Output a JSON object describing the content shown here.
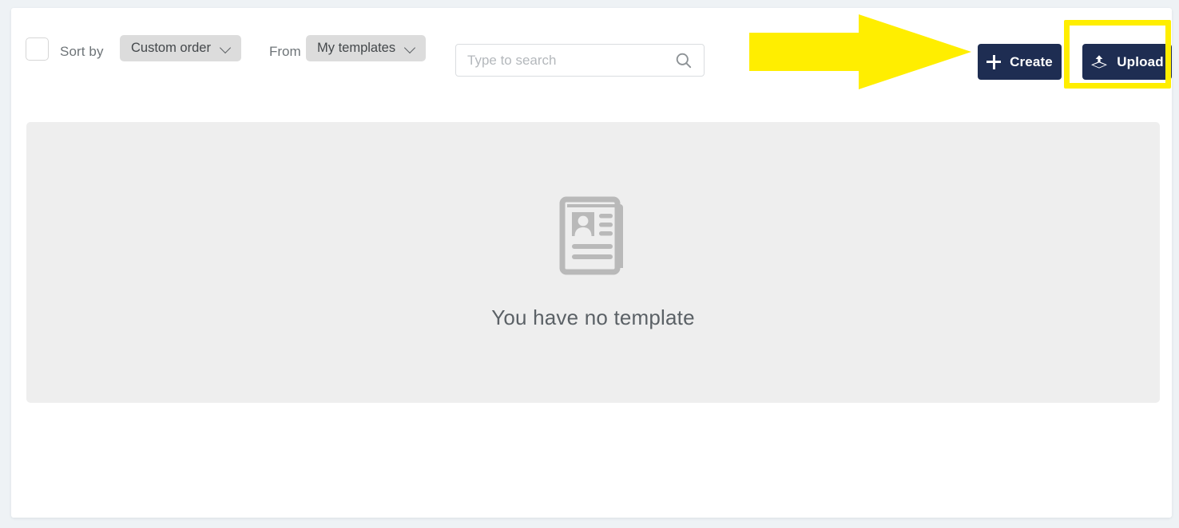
{
  "toolbar": {
    "select_all_checkbox": {
      "name": "select-all",
      "checked": false
    },
    "sort_by_label": "Sort by",
    "sort_by_value": "Custom order",
    "from_label": "From",
    "from_value": "My templates",
    "search": {
      "value": "",
      "placeholder": "Type to search",
      "icon": "search-icon"
    },
    "create_button": {
      "label": "Create",
      "icon": "plus-icon"
    },
    "upload_button": {
      "label": "Upload",
      "icon": "upload-icon"
    }
  },
  "main": {
    "empty_state": {
      "icon": "template-document-icon",
      "message": "You have no template"
    }
  },
  "annotations": {
    "arrow": {
      "name": "pointer-arrow",
      "direction": "right",
      "color": "#ffee00",
      "points_to": "Upload"
    },
    "highlight_box": {
      "name": "highlight-box",
      "color": "#ffee00",
      "target": "Upload"
    }
  },
  "colors": {
    "page_background": "#eef2f5",
    "card_background": "#ffffff",
    "panel_background": "#eeeeee",
    "button_dark": "#1e2d52",
    "pill_background": "#dcdcdc",
    "annotation_yellow": "#ffee00",
    "text_muted": "#6e7478"
  }
}
